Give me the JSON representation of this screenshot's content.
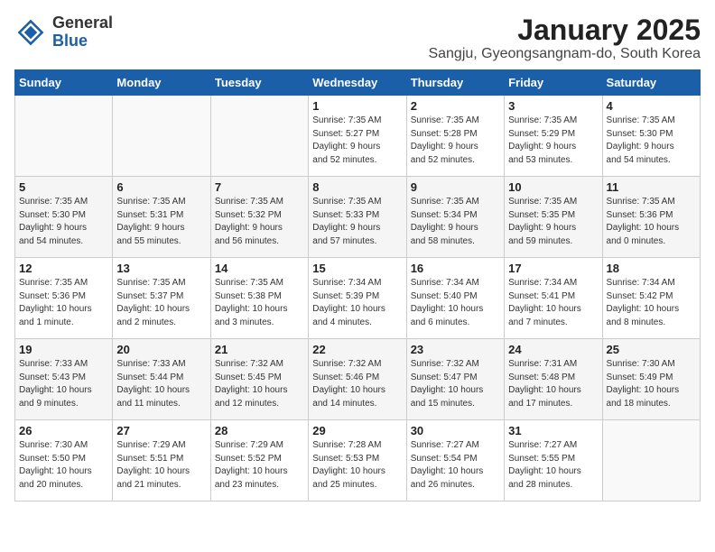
{
  "logo": {
    "general": "General",
    "blue": "Blue"
  },
  "title": "January 2025",
  "subtitle": "Sangju, Gyeongsangnam-do, South Korea",
  "days_of_week": [
    "Sunday",
    "Monday",
    "Tuesday",
    "Wednesday",
    "Thursday",
    "Friday",
    "Saturday"
  ],
  "weeks": [
    [
      {
        "day": "",
        "info": ""
      },
      {
        "day": "",
        "info": ""
      },
      {
        "day": "",
        "info": ""
      },
      {
        "day": "1",
        "info": "Sunrise: 7:35 AM\nSunset: 5:27 PM\nDaylight: 9 hours\nand 52 minutes."
      },
      {
        "day": "2",
        "info": "Sunrise: 7:35 AM\nSunset: 5:28 PM\nDaylight: 9 hours\nand 52 minutes."
      },
      {
        "day": "3",
        "info": "Sunrise: 7:35 AM\nSunset: 5:29 PM\nDaylight: 9 hours\nand 53 minutes."
      },
      {
        "day": "4",
        "info": "Sunrise: 7:35 AM\nSunset: 5:30 PM\nDaylight: 9 hours\nand 54 minutes."
      }
    ],
    [
      {
        "day": "5",
        "info": "Sunrise: 7:35 AM\nSunset: 5:30 PM\nDaylight: 9 hours\nand 54 minutes."
      },
      {
        "day": "6",
        "info": "Sunrise: 7:35 AM\nSunset: 5:31 PM\nDaylight: 9 hours\nand 55 minutes."
      },
      {
        "day": "7",
        "info": "Sunrise: 7:35 AM\nSunset: 5:32 PM\nDaylight: 9 hours\nand 56 minutes."
      },
      {
        "day": "8",
        "info": "Sunrise: 7:35 AM\nSunset: 5:33 PM\nDaylight: 9 hours\nand 57 minutes."
      },
      {
        "day": "9",
        "info": "Sunrise: 7:35 AM\nSunset: 5:34 PM\nDaylight: 9 hours\nand 58 minutes."
      },
      {
        "day": "10",
        "info": "Sunrise: 7:35 AM\nSunset: 5:35 PM\nDaylight: 9 hours\nand 59 minutes."
      },
      {
        "day": "11",
        "info": "Sunrise: 7:35 AM\nSunset: 5:36 PM\nDaylight: 10 hours\nand 0 minutes."
      }
    ],
    [
      {
        "day": "12",
        "info": "Sunrise: 7:35 AM\nSunset: 5:36 PM\nDaylight: 10 hours\nand 1 minute."
      },
      {
        "day": "13",
        "info": "Sunrise: 7:35 AM\nSunset: 5:37 PM\nDaylight: 10 hours\nand 2 minutes."
      },
      {
        "day": "14",
        "info": "Sunrise: 7:35 AM\nSunset: 5:38 PM\nDaylight: 10 hours\nand 3 minutes."
      },
      {
        "day": "15",
        "info": "Sunrise: 7:34 AM\nSunset: 5:39 PM\nDaylight: 10 hours\nand 4 minutes."
      },
      {
        "day": "16",
        "info": "Sunrise: 7:34 AM\nSunset: 5:40 PM\nDaylight: 10 hours\nand 6 minutes."
      },
      {
        "day": "17",
        "info": "Sunrise: 7:34 AM\nSunset: 5:41 PM\nDaylight: 10 hours\nand 7 minutes."
      },
      {
        "day": "18",
        "info": "Sunrise: 7:34 AM\nSunset: 5:42 PM\nDaylight: 10 hours\nand 8 minutes."
      }
    ],
    [
      {
        "day": "19",
        "info": "Sunrise: 7:33 AM\nSunset: 5:43 PM\nDaylight: 10 hours\nand 9 minutes."
      },
      {
        "day": "20",
        "info": "Sunrise: 7:33 AM\nSunset: 5:44 PM\nDaylight: 10 hours\nand 11 minutes."
      },
      {
        "day": "21",
        "info": "Sunrise: 7:32 AM\nSunset: 5:45 PM\nDaylight: 10 hours\nand 12 minutes."
      },
      {
        "day": "22",
        "info": "Sunrise: 7:32 AM\nSunset: 5:46 PM\nDaylight: 10 hours\nand 14 minutes."
      },
      {
        "day": "23",
        "info": "Sunrise: 7:32 AM\nSunset: 5:47 PM\nDaylight: 10 hours\nand 15 minutes."
      },
      {
        "day": "24",
        "info": "Sunrise: 7:31 AM\nSunset: 5:48 PM\nDaylight: 10 hours\nand 17 minutes."
      },
      {
        "day": "25",
        "info": "Sunrise: 7:30 AM\nSunset: 5:49 PM\nDaylight: 10 hours\nand 18 minutes."
      }
    ],
    [
      {
        "day": "26",
        "info": "Sunrise: 7:30 AM\nSunset: 5:50 PM\nDaylight: 10 hours\nand 20 minutes."
      },
      {
        "day": "27",
        "info": "Sunrise: 7:29 AM\nSunset: 5:51 PM\nDaylight: 10 hours\nand 21 minutes."
      },
      {
        "day": "28",
        "info": "Sunrise: 7:29 AM\nSunset: 5:52 PM\nDaylight: 10 hours\nand 23 minutes."
      },
      {
        "day": "29",
        "info": "Sunrise: 7:28 AM\nSunset: 5:53 PM\nDaylight: 10 hours\nand 25 minutes."
      },
      {
        "day": "30",
        "info": "Sunrise: 7:27 AM\nSunset: 5:54 PM\nDaylight: 10 hours\nand 26 minutes."
      },
      {
        "day": "31",
        "info": "Sunrise: 7:27 AM\nSunset: 5:55 PM\nDaylight: 10 hours\nand 28 minutes."
      },
      {
        "day": "",
        "info": ""
      }
    ]
  ]
}
